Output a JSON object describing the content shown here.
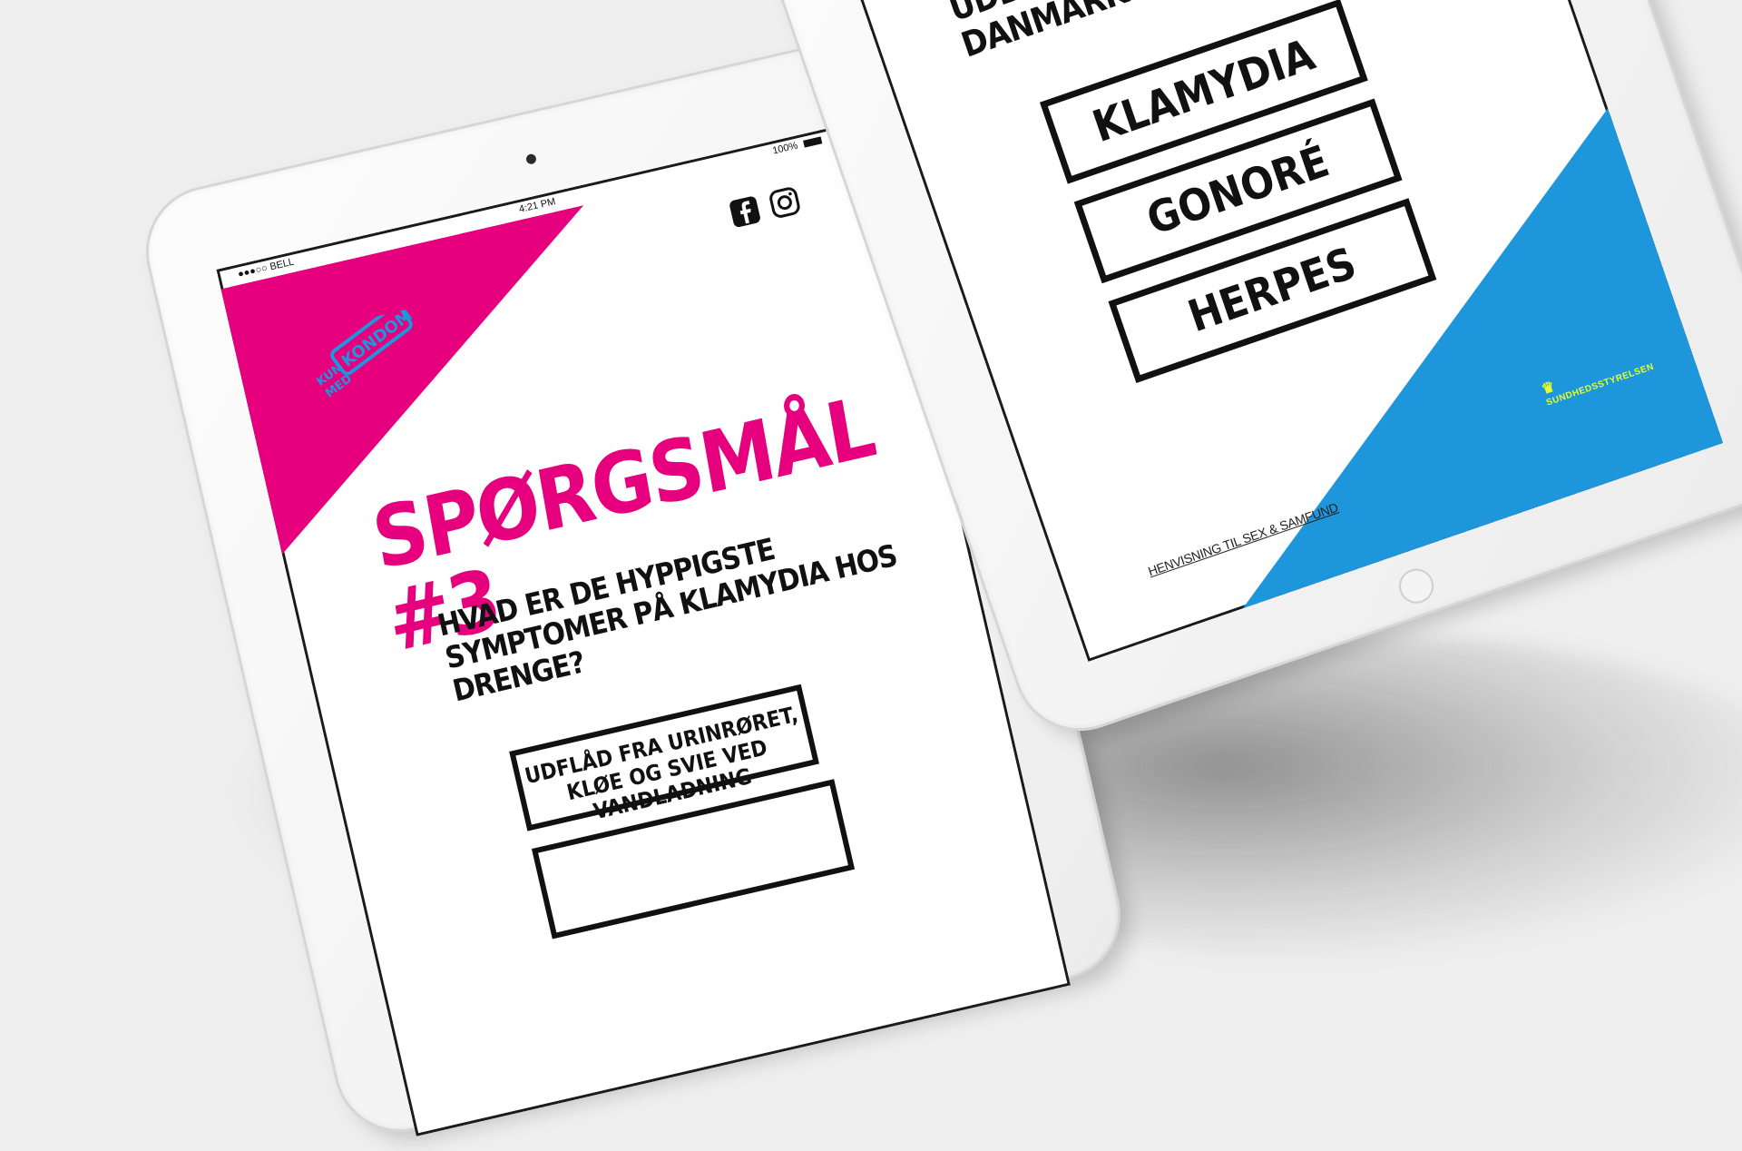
{
  "left_tablet": {
    "status_bar": {
      "carrier": "●●●○○ BELL",
      "time": "4:21 PM",
      "battery": "100%"
    },
    "brand_logo": {
      "line1": "KUN",
      "line2": "MED",
      "word": "KONDOM"
    },
    "question_heading": "SPØRGSMÅL #3",
    "question_text": "HVAD ER DE HYPPIGSTE SYMPTOMER PÅ KLAMYDIA HOS DRENGE?",
    "answers": [
      {
        "label": "UDFLÅD FRA URINRØRET, KLØE OG SVIE VED VANDLADNING"
      },
      {
        "label": ""
      }
    ]
  },
  "right_tablet": {
    "question_text": "HVAD ER DEN MEST UDBREDTE SEXSYGDOM I DANMARK?",
    "answers": [
      {
        "label": "KLAMYDIA"
      },
      {
        "label": "GONORÉ"
      },
      {
        "label": "HERPES"
      }
    ],
    "referral_link": "HENVISNING TIL SEX & SAMFUND",
    "agency_logo": "SUNDHEDSSTYRELSEN"
  },
  "colors": {
    "background": "#eeeeee",
    "brand_pink": "#e6007e",
    "brand_blue": "#1d96dc",
    "agency_yellow": "#e6ff2b",
    "ink": "#111111"
  },
  "icons": {
    "facebook": "facebook-icon",
    "instagram": "instagram-icon",
    "bluetooth": "bluetooth-icon",
    "wifi": "wifi-icon",
    "battery": "battery-icon",
    "crown": "crown-icon"
  }
}
